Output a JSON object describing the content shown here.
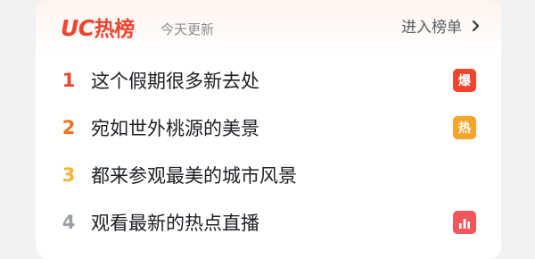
{
  "header": {
    "brand_latin": "UC",
    "brand_cjk": "热榜",
    "subtitle": "今天更新",
    "enter_label": "进入榜单",
    "brand_color": "#f0442f"
  },
  "items": [
    {
      "rank": "1",
      "title": "这个假期很多新去处",
      "rank_color": "#f0442f",
      "badge": {
        "text": "爆",
        "color": "#f0442f"
      }
    },
    {
      "rank": "2",
      "title": "宛如世外桃源的美景",
      "rank_color": "#f56e1c",
      "badge": {
        "text": "热",
        "color": "#f5a52a"
      }
    },
    {
      "rank": "3",
      "title": "都来参观最美的城市风景",
      "rank_color": "#f7b431",
      "badge": null
    },
    {
      "rank": "4",
      "title": "观看最新的热点直播",
      "rank_color": "#9a9ea5",
      "badge": {
        "icon": "bar-chart-icon",
        "color": "#f0575b"
      }
    }
  ]
}
